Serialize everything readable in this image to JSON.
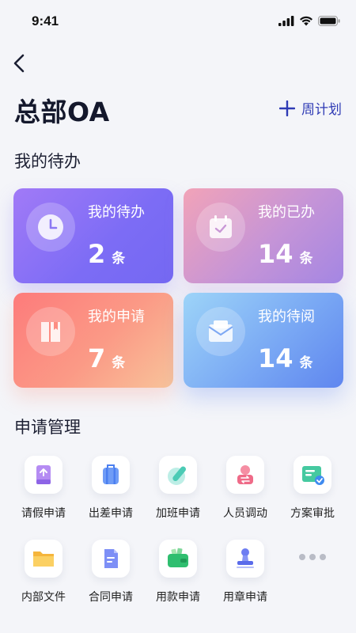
{
  "status_bar": {
    "time": "9:41"
  },
  "header": {
    "title": "总部OA",
    "week_plan_label": "周计划"
  },
  "todo_section": {
    "title": "我的待办",
    "cards": [
      {
        "label": "我的待办",
        "count": "2",
        "unit": "条",
        "icon": "clock-icon"
      },
      {
        "label": "我的已办",
        "count": "14",
        "unit": "条",
        "icon": "calendar-check-icon"
      },
      {
        "label": "我的申请",
        "count": "7",
        "unit": "条",
        "icon": "book-icon"
      },
      {
        "label": "我的待阅",
        "count": "14",
        "unit": "条",
        "icon": "mail-icon"
      }
    ]
  },
  "apply_section": {
    "title": "申请管理",
    "items": [
      {
        "label": "请假申请",
        "icon": "leave-icon"
      },
      {
        "label": "出差申请",
        "icon": "luggage-icon"
      },
      {
        "label": "加班申请",
        "icon": "pen-icon"
      },
      {
        "label": "人员调动",
        "icon": "transfer-icon"
      },
      {
        "label": "方案审批",
        "icon": "approval-icon"
      },
      {
        "label": "内部文件",
        "icon": "folder-icon"
      },
      {
        "label": "合同申请",
        "icon": "contract-icon"
      },
      {
        "label": "用款申请",
        "icon": "wallet-icon"
      },
      {
        "label": "用章申请",
        "icon": "stamp-icon"
      }
    ],
    "more_icon": "more-icon"
  },
  "colors": {
    "accent": "#2f3bb5",
    "background": "#f4f5f9"
  }
}
